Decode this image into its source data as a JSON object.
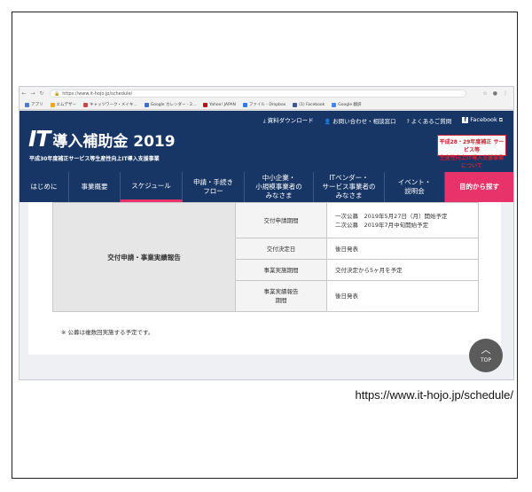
{
  "browser": {
    "url": "https://www.it-hojo.jp/schedule/",
    "bookmarks": [
      {
        "label": "アプリ",
        "color": "#4a7bd0"
      },
      {
        "label": "エムデザー",
        "color": "#f2a900"
      },
      {
        "label": "キャッツワーク・メイキ...",
        "color": "#c44"
      },
      {
        "label": "Google カレンダー - 2...",
        "color": "#3b6fd6"
      },
      {
        "label": "Yahoo! JAPAN",
        "color": "#d0021b"
      },
      {
        "label": "ファイル - Dropbox",
        "color": "#2d7be0"
      },
      {
        "label": "(1) Facebook",
        "color": "#3b5998"
      },
      {
        "label": "Google 翻訳",
        "color": "#4285f4"
      }
    ]
  },
  "header": {
    "util_links": {
      "download": "資料ダウンロード",
      "contact": "お問い合わせ・相談窓口",
      "faq": "よくあるご質問",
      "facebook": "Facebook"
    },
    "logo_it": "IT",
    "logo_name": "導入補助金 2019",
    "logo_sub": "平成30年度補正サービス等生産性向上IT導入支援事業",
    "promo_line1": "平成28・29年度補正 サービス等",
    "promo_line2": "生産性向上IT導入支援事業について"
  },
  "menu": [
    "はじめに",
    "事業概要",
    "スケジュール",
    "申請・手続き\nフロー",
    "中小企業・\n小規模事業者の\nみなさま",
    "ITベンダー・\nサービス事業者の\nみなさま",
    "イベント・\n説明会",
    "目的から探す"
  ],
  "schedule": {
    "section_label": "交付申請・事業実績報告",
    "rows": [
      {
        "label": "交付申請期間",
        "value1": "一次公募　2019年5月27日（月）開始予定",
        "value2": "二次公募　2019年7月中旬開始予定"
      },
      {
        "label": "交付決定日",
        "value1": "後日発表"
      },
      {
        "label": "事業実施期間",
        "value1": "交付決定から5ヶ月を予定"
      },
      {
        "label": "事業実績報告\n期間",
        "value1": "後日発表"
      }
    ],
    "note": "※ 公募は複数回実施する予定です。"
  },
  "top_button": "TOP",
  "caption": "https://www.it-hojo.jp/schedule/"
}
